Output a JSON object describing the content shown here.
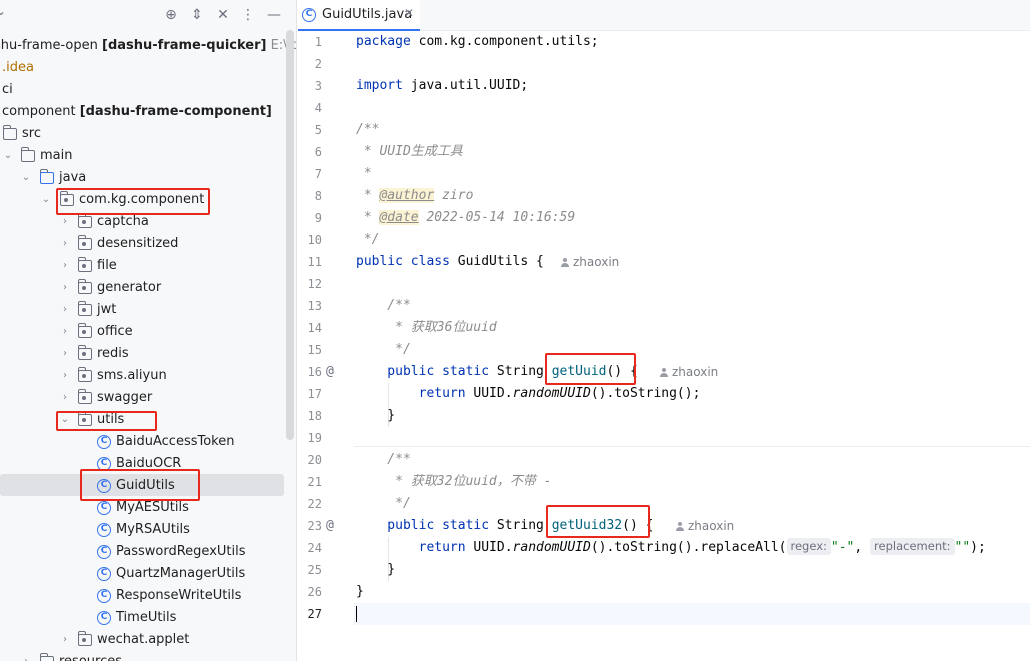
{
  "project_tree": {
    "rows": [
      {
        "id": "root",
        "prefix": "shu-frame-open ",
        "bold": "[dashu-frame-quicker]",
        "suffix": " E:\\Ide"
      },
      {
        "id": "idea",
        "label": ".idea"
      },
      {
        "id": "ci",
        "label": "ci"
      },
      {
        "id": "component",
        "prefix": "component ",
        "bold": "[dashu-frame-component]"
      },
      {
        "id": "src",
        "label": "src"
      },
      {
        "id": "main",
        "label": "main"
      },
      {
        "id": "java",
        "label": "java"
      },
      {
        "id": "pkg",
        "label": "com.kg.component"
      },
      {
        "id": "captcha",
        "label": "captcha"
      },
      {
        "id": "desensitized",
        "label": "desensitized"
      },
      {
        "id": "file",
        "label": "file"
      },
      {
        "id": "generator",
        "label": "generator"
      },
      {
        "id": "jwt",
        "label": "jwt"
      },
      {
        "id": "office",
        "label": "office"
      },
      {
        "id": "redis",
        "label": "redis"
      },
      {
        "id": "sms",
        "label": "sms.aliyun"
      },
      {
        "id": "swagger",
        "label": "swagger"
      },
      {
        "id": "utils",
        "label": "utils"
      },
      {
        "id": "baiduaccesstoken",
        "label": "BaiduAccessToken"
      },
      {
        "id": "baiduocr",
        "label": "BaiduOCR"
      },
      {
        "id": "guidutils",
        "label": "GuidUtils"
      },
      {
        "id": "myaesutils",
        "label": "MyAESUtils"
      },
      {
        "id": "myrsautils",
        "label": "MyRSAUtils"
      },
      {
        "id": "passwordregexutils",
        "label": "PasswordRegexUtils"
      },
      {
        "id": "quartzmanagerutils",
        "label": "QuartzManagerUtils"
      },
      {
        "id": "responsewriteutils",
        "label": "ResponseWriteUtils"
      },
      {
        "id": "timeutils",
        "label": "TimeUtils"
      },
      {
        "id": "wechat",
        "label": "wechat.applet"
      },
      {
        "id": "resources",
        "label": "resources"
      }
    ]
  },
  "toolbar": {
    "locate_icon": "crosshair-icon",
    "expand_icon": "expand-all-icon",
    "collapse_icon": "collapse-all-icon",
    "more_icon": "more-icon",
    "minimize_icon": "minimize-icon"
  },
  "editor": {
    "tab_label": "GuidUtils.java",
    "class_icon_letter": "C",
    "line_numbers": [
      "1",
      "2",
      "3",
      "4",
      "5",
      "6",
      "7",
      "8",
      "9",
      "10",
      "11",
      "12",
      "13",
      "14",
      "15",
      "16",
      "17",
      "18",
      "19",
      "20",
      "21",
      "22",
      "23",
      "24",
      "25",
      "26",
      "27"
    ],
    "gutter_marks": {
      "l16": "@",
      "l23": "@"
    },
    "code": {
      "l1_kw": "package",
      "l1_rest": " com.kg.component.utils;",
      "l3_kw": "import",
      "l3_rest": " java.util.UUID;",
      "l5": "/**",
      "l6": " * UUID生成工具",
      "l7": " *",
      "l8_pre": " * ",
      "l8_tag": "@author",
      "l8_rest": " ziro",
      "l9_pre": " * ",
      "l9_tag": "@date",
      "l9_rest": " 2022-05-14 10:16:59",
      "l10": " */",
      "l11_kw": "public class",
      "l11_rest": " GuidUtils {",
      "l13": "    /**",
      "l14": "     * 获取36位uuid",
      "l15": "     */",
      "l16_kw": "    public static",
      "l16_type": " String ",
      "l16_fn": "getUuid",
      "l16_rest": "() {",
      "l17_kw": "        return",
      "l17_a": " UUID.",
      "l17_st": "randomUUID",
      "l17_b": "().toString();",
      "l18": "    }",
      "l20": "    /**",
      "l21": "     * 获取32位uuid，不带 -",
      "l22": "     */",
      "l23_kw": "    public static",
      "l23_type": " String ",
      "l23_fn": "getUuid32",
      "l23_rest": "() {",
      "l24_kw": "        return",
      "l24_a": " UUID.",
      "l24_st": "randomUUID",
      "l24_b": "().toString().replaceAll(",
      "l24_hint1": "regex:",
      "l24_str1": "\"-\"",
      "l24_comma": ", ",
      "l24_hint2": "replacement:",
      "l24_str2": "\"\"",
      "l24_end": ");",
      "l25": "    }",
      "l26": "}"
    },
    "author_hint": "zhaoxin"
  },
  "colors": {
    "highlight_box": "#e8281c",
    "accent": "#3574f0"
  }
}
